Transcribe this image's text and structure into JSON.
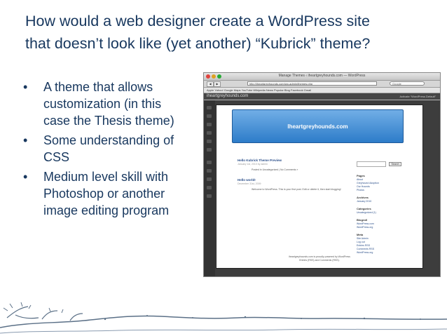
{
  "slide": {
    "title_line1": "How would a web designer create a WordPress site",
    "title_line2": "that doesn’t look like  (yet another) “Kubrick” theme?",
    "bullet_char": "•",
    "bullets": [
      {
        "line1": "A theme that allows",
        "line2": "customization (in this",
        "line3": "case the Thesis theme)"
      },
      {
        "line1": "Some understanding of",
        "line2": "CSS"
      },
      {
        "line1": "Medium level skill with",
        "line2": "Photoshop or another",
        "line3": "image editing program"
      }
    ]
  },
  "screenshot": {
    "window_title": "Manage Themes ‹ iheartgreyhounds.com — WordPress",
    "url": "http://iheartgreyhounds.com/wp-admin/themes.php",
    "search_placeholder": "Google",
    "back_label": "◀",
    "forward_label": "▶",
    "bookmarks": "Apple   Yahoo!   Google Maps   YouTube   Wikipedia   News   Popular   Blog   Facebook   Gmail",
    "admin_site_name": "iheartgreyhounds.com",
    "admin_right_text": "Activate “WordPress Default”",
    "site_header": "Iheartgreyhounds.com",
    "posts": [
      {
        "title": "Hello Kubrick Theme Preview",
        "meta": "January 1st, 2010 by admin",
        "body": "Posted in Uncategorized | No Comments »"
      },
      {
        "title": "Hello world!",
        "meta": "December 31st, 2009",
        "body": "Welcome to WordPress. This is your first post. Edit or delete it, then start blogging!"
      }
    ],
    "search_button": "Search",
    "sidebar_sections": [
      {
        "heading": "Pages",
        "items": [
          "About",
          "Greyhound Adoption",
          "Our Hounds",
          "Photos"
        ]
      },
      {
        "heading": "Archives",
        "items": [
          "January 2010"
        ]
      },
      {
        "heading": "Categories",
        "items": [
          "Uncategorized (1)"
        ]
      },
      {
        "heading": "Blogroll",
        "items": [
          "WordPress.com",
          "WordPress.org"
        ]
      },
      {
        "heading": "Meta",
        "items": [
          "Site Admin",
          "Log out",
          "Entries RSS",
          "Comments RSS",
          "WordPress.org"
        ]
      }
    ],
    "footer_line1": "iheartgreyhounds.com is proudly powered by WordPress",
    "footer_line2": "Entries (RSS) and Comments (RSS)."
  },
  "colors": {
    "title_text": "#17375e",
    "banner": "#3d87d1",
    "admin_bar": "#464646",
    "decoration": "#5b7087"
  }
}
